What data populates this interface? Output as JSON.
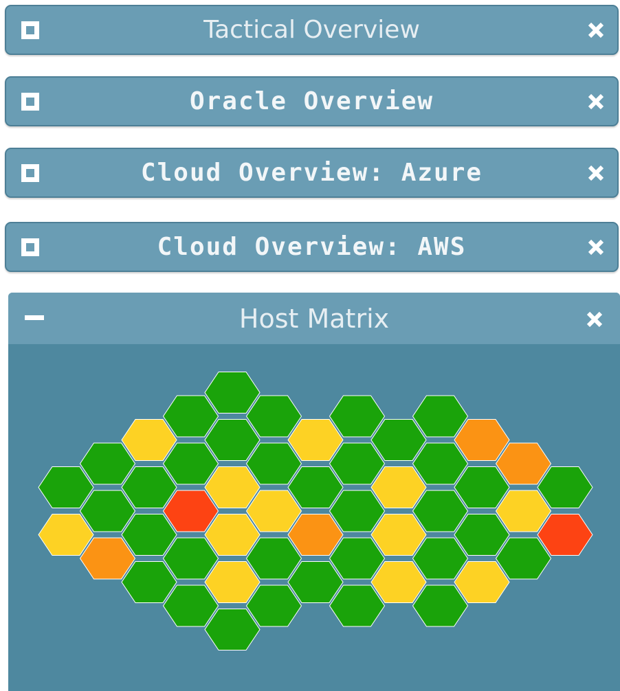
{
  "panels": [
    {
      "id": "tactical",
      "title": "Tactical Overview",
      "style": "light"
    },
    {
      "id": "oracle",
      "title": "Oracle Overview",
      "style": "bold"
    },
    {
      "id": "azure",
      "title": "Cloud Overview: Azure",
      "style": "bold"
    },
    {
      "id": "aws",
      "title": "Cloud Overview: AWS",
      "style": "bold"
    }
  ],
  "host_matrix": {
    "title": "Host Matrix",
    "status_colors": {
      "ok": "#1aa30a",
      "warning": "#fdd224",
      "elevated": "#fb9314",
      "critical": "#fd4313"
    },
    "columns": [
      [
        "ok",
        "warning"
      ],
      [
        "ok",
        "ok",
        "elevated"
      ],
      [
        "warning",
        "ok",
        "ok",
        "ok"
      ],
      [
        "ok",
        "ok",
        "critical",
        "ok",
        "ok"
      ],
      [
        "ok",
        "ok",
        "warning",
        "warning",
        "warning",
        "ok"
      ],
      [
        "ok",
        "ok",
        "warning",
        "ok",
        "ok"
      ],
      [
        "warning",
        "ok",
        "elevated",
        "ok"
      ],
      [
        "ok",
        "ok",
        "ok",
        "ok",
        "ok"
      ],
      [
        "ok",
        "warning",
        "warning",
        "warning"
      ],
      [
        "ok",
        "ok",
        "ok",
        "ok",
        "ok"
      ],
      [
        "elevated",
        "ok",
        "ok",
        "warning"
      ],
      [
        "elevated",
        "warning",
        "ok"
      ],
      [
        "ok",
        "critical"
      ]
    ]
  },
  "icons": {
    "restore": "restore-icon",
    "minimize": "minimize-icon",
    "close": "close-icon"
  }
}
